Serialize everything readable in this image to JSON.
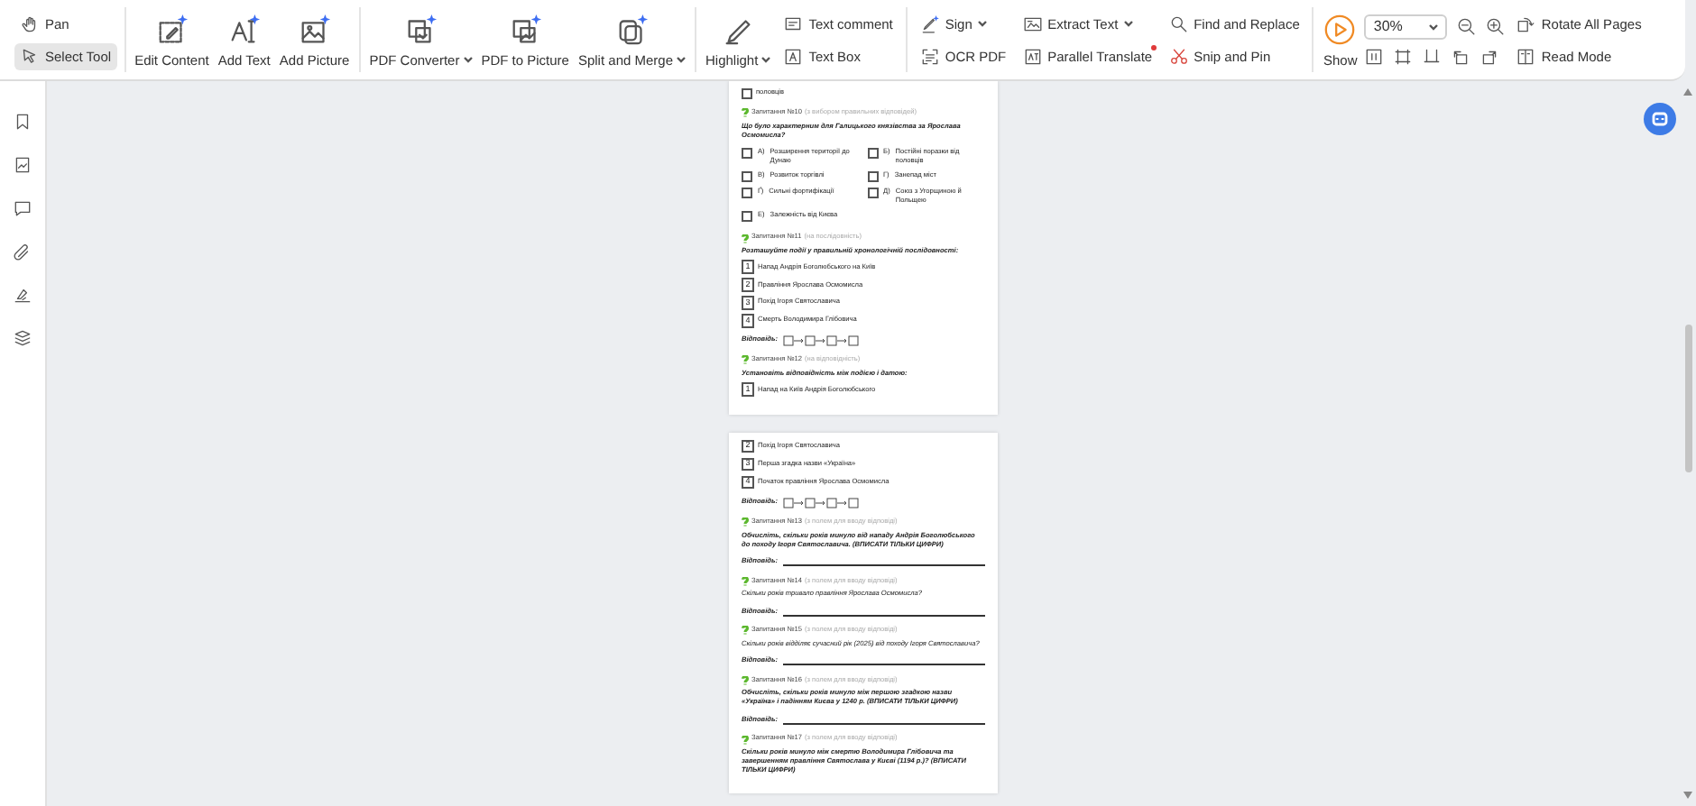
{
  "toolbar": {
    "groups": [
      [
        {
          "kind": "stack",
          "items": [
            {
              "label": "Pan",
              "selected": false
            },
            {
              "label": "Select Tool",
              "selected": true
            }
          ]
        }
      ],
      [
        {
          "kind": "large",
          "label": "Edit Content",
          "dropdown": false
        },
        {
          "kind": "large",
          "label": "Add Text",
          "dropdown": false
        },
        {
          "kind": "large",
          "label": "Add Picture",
          "dropdown": false
        }
      ],
      [
        {
          "kind": "large",
          "label": "PDF Converter",
          "dropdown": true
        },
        {
          "kind": "large",
          "label": "PDF to Picture",
          "dropdown": false
        },
        {
          "kind": "large",
          "label": "Split and Merge",
          "dropdown": true
        }
      ],
      [
        {
          "kind": "large",
          "label": "Highlight",
          "dropdown": true
        },
        {
          "kind": "stack",
          "items": [
            {
              "label": "Text comment",
              "selected": false
            },
            {
              "label": "Text Box",
              "selected": false
            }
          ]
        }
      ],
      [
        {
          "kind": "stack",
          "items": [
            {
              "label": "Sign",
              "selected": false,
              "dropdown": true
            },
            {
              "label": "OCR PDF",
              "selected": false
            }
          ]
        },
        {
          "kind": "stack",
          "items": [
            {
              "label": "Extract Text",
              "selected": false,
              "dropdown": true
            },
            {
              "label": "Parallel Translate",
              "selected": false,
              "dot": true
            }
          ]
        },
        {
          "kind": "stack",
          "items": [
            {
              "label": "Find and Replace",
              "selected": false
            },
            {
              "label": "Snip and Pin",
              "selected": false
            }
          ]
        }
      ],
      [
        {
          "kind": "large",
          "label": "Show",
          "dropdown": false
        },
        {
          "kind": "zoom",
          "value": "30%"
        },
        {
          "kind": "stack",
          "items": [
            {
              "label": "Rotate All Pages",
              "selected": false
            },
            {
              "label": "Read Mode",
              "selected": false
            }
          ]
        }
      ]
    ]
  },
  "pages": [
    {
      "blocks": [
        {
          "kind": "cut_option",
          "text": "половців",
          "checked": false
        },
        {
          "kind": "header",
          "number": "Запитання №10",
          "note": "(з вибором правильних відповідей)"
        },
        {
          "kind": "question",
          "text": "Що було характерним для Галицького князівства за Ярослава Осмомисла?",
          "emphasis": true
        },
        {
          "kind": "options",
          "items": [
            {
              "letter": "А)",
              "text": "Розширення території до Дунаю",
              "checked": false
            },
            {
              "letter": "Б)",
              "text": "Постійні поразки від половців",
              "checked": false
            },
            {
              "letter": "В)",
              "text": "Розвиток торгівлі",
              "checked": false
            },
            {
              "letter": "Г)",
              "text": "Занепад міст",
              "checked": false
            },
            {
              "letter": "Ґ)",
              "text": "Сильні фортифікації",
              "checked": false
            },
            {
              "letter": "Д)",
              "text": "Союз з Угорщиною й Польщею",
              "checked": false
            },
            {
              "letter": "Е)",
              "text": "Залежність від Києва",
              "checked": false
            }
          ]
        },
        {
          "kind": "header",
          "number": "Запитання №11",
          "note": "(на послідовність)"
        },
        {
          "kind": "question",
          "text": "Розташуйте події у правильній хронологічній послідовності:",
          "emphasis": true
        },
        {
          "kind": "numbered",
          "number": "1",
          "text": "Напад Андрія Боголюбського на Київ"
        },
        {
          "kind": "numbered",
          "number": "2",
          "text": "Правління Ярослава Осмомисла"
        },
        {
          "kind": "numbered",
          "number": "3",
          "text": "Похід Ігоря Святославича"
        },
        {
          "kind": "numbered",
          "number": "4",
          "text": "Смерть Володимира Глібовича"
        },
        {
          "kind": "sequence_answer",
          "label": "Відповідь:"
        },
        {
          "kind": "header",
          "number": "Запитання №12",
          "note": "(на відповідність)"
        },
        {
          "kind": "question",
          "text": "Установіть відповідність між подією і датою:",
          "emphasis": true
        },
        {
          "kind": "numbered",
          "number": "1",
          "text": "Напад на Київ Андрія Боголюбського"
        }
      ]
    },
    {
      "blocks": [
        {
          "kind": "numbered",
          "number": "2",
          "text": "Похід Ігоря Святославича"
        },
        {
          "kind": "numbered",
          "number": "3",
          "text": "Перша згадка назви «Україна»"
        },
        {
          "kind": "numbered",
          "number": "4",
          "text": "Початок правління Ярослава Осмомисла"
        },
        {
          "kind": "sequence_answer",
          "label": "Відповідь:"
        },
        {
          "kind": "header",
          "number": "Запитання №13",
          "note": "(з полем для вводу відповіді)"
        },
        {
          "kind": "question",
          "text": "Обчисліть, скільки років минуло від нападу Андрія Боголюбського до походу Ігоря Святославича. (ВПИСАТИ ТІЛЬКИ ЦИФРИ)",
          "emphasis": true
        },
        {
          "kind": "line_answer",
          "label": "Відповідь:"
        },
        {
          "kind": "header",
          "number": "Запитання №14",
          "note": "(з полем для вводу відповіді)"
        },
        {
          "kind": "question",
          "text": "Скільки років тривало правління Ярослава Осмомисла?",
          "emphasis": false
        },
        {
          "kind": "line_answer",
          "label": "Відповідь:"
        },
        {
          "kind": "header",
          "number": "Запитання №15",
          "note": "(з полем для вводу відповіді)"
        },
        {
          "kind": "question",
          "text": "Скільки років відділяє сучасний рік (2025) від походу Ігоря Святославича?",
          "emphasis": false
        },
        {
          "kind": "line_answer",
          "label": "Відповідь:"
        },
        {
          "kind": "header",
          "number": "Запитання №16",
          "note": "(з полем для вводу відповіді)"
        },
        {
          "kind": "question",
          "text": "Обчисліть, скільки років минуло між першою згадкою назви «Україна» і падінням Києва у 1240 р. (ВПИСАТИ ТІЛЬКИ ЦИФРИ)",
          "emphasis": true
        },
        {
          "kind": "line_answer",
          "label": "Відповідь:"
        },
        {
          "kind": "header",
          "number": "Запитання №17",
          "note": "(з полем для вводу відповіді)"
        },
        {
          "kind": "question",
          "text": "Скільки років минуло між смертю Володимира Глібовича та завершенням правління Святослава у Києві (1194 р.)? (ВПИСАТИ ТІЛЬКИ ЦИФРИ)",
          "emphasis": true
        }
      ]
    }
  ]
}
